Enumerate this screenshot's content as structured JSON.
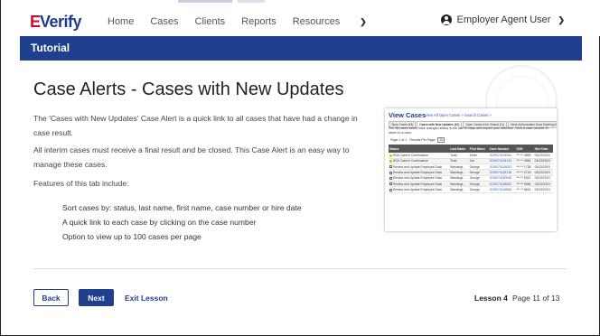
{
  "brand": {
    "logo_e": "E",
    "logo_text": "Verify"
  },
  "nav": {
    "items": [
      "Home",
      "Cases",
      "Clients",
      "Reports",
      "Resources"
    ],
    "resources_chevron": "chevron-down-icon",
    "user_label": "Employer Agent User"
  },
  "tutorial_bar": {
    "label": "Tutorial"
  },
  "page": {
    "title": "Case Alerts - Cases with New Updates",
    "para1": "The 'Cases with New Updates' Case Alert is a quick link to all cases that have had a change in case result.",
    "para2": "All interim cases must receive a final result and be closed. This Case Alert is an easy way to manage these cases.",
    "para3": "Features of this tab include:",
    "bullets": [
      "Sort cases by: status, last name, first name, case number or hire date",
      "A quick link to each case by clicking on the case number",
      "Option to view up to 100 cases per page"
    ]
  },
  "screenshot": {
    "title": "View Cases",
    "links": "View All Open Cases >   Search Cases >",
    "tabs": [
      "Open Cases (48)",
      "Cases with New Updates (10)",
      "Open Cases to be Closed (11)",
      "Work Authorization Docs Expiring (0)"
    ],
    "active_tab": 1,
    "description": "The 48 cases below have changed status in the last 30 days and require your attention. Click a case number to return to a case.",
    "pager_label": "Page 1 of 1",
    "results_label": "Results Per Page:",
    "results_value": "25",
    "columns": [
      "Status",
      "Last Name",
      "First Name",
      "Case Number",
      "SSN",
      "Hire Date"
    ],
    "rows": [
      [
        "warn",
        "SSA Case in Continuance",
        "Todd",
        "Kevin",
        "2019074104064",
        "*** ** 4899",
        "03/12/2019"
      ],
      [
        "warn",
        "SSA Case in Continuance",
        "Todd",
        "Joe",
        "2019074154134",
        "*** ** 4954",
        "03/12/2019"
      ],
      [
        "doc",
        "Review and Update Employee Data",
        "Washingt...",
        "George",
        "2019074145002",
        "*** ** 1738",
        "03/12/2019"
      ],
      [
        "doc",
        "Review and Update Employee Data",
        "Washingt...",
        "George",
        "2019074155748",
        "*** ** 2743",
        "03/12/2019"
      ],
      [
        "doc",
        "Review and Update Employee Data",
        "Washingt...",
        "George",
        "2019074150046",
        "*** ** 6321",
        "03/12/2019"
      ],
      [
        "doc",
        "Review and Update Employee Data",
        "Washingt...",
        "George",
        "2019074148052",
        "*** ** 9456",
        "03/12/2019"
      ],
      [
        "doc",
        "Review and Update Employee Data",
        "Washingt...",
        "George",
        "2019074146965",
        "*** ** 8614",
        "03/12/2019"
      ]
    ]
  },
  "footer": {
    "back_label": "Back",
    "next_label": "Next",
    "exit_label": "Exit Lesson",
    "lesson_label": "Lesson 4",
    "page_label": "Page 11 of 13"
  }
}
